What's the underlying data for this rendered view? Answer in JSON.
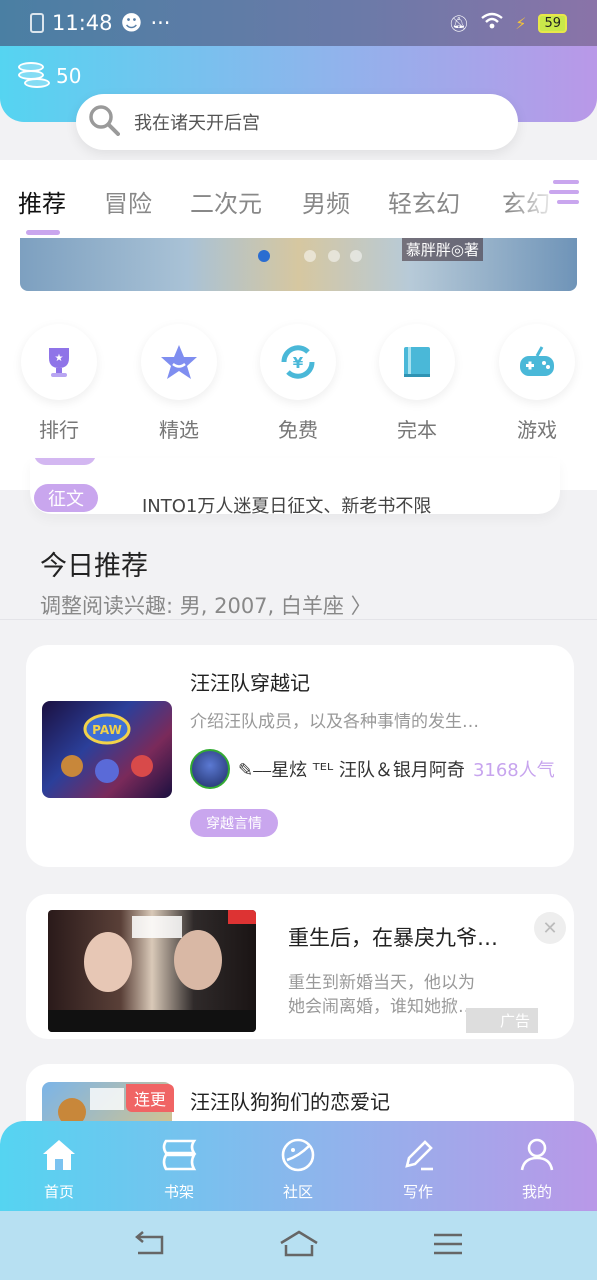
{
  "status_bar": {
    "time": "11:48",
    "extra": "···",
    "battery": "59"
  },
  "header": {
    "coins": "50"
  },
  "search": {
    "placeholder": "我在诸天开后宫"
  },
  "tabs": [
    "推荐",
    "冒险",
    "二次元",
    "男频",
    "轻玄幻",
    "玄幻"
  ],
  "banner": {
    "author": "慕胖胖◎著"
  },
  "quick_links": [
    {
      "label": "排行",
      "icon": "trophy-icon"
    },
    {
      "label": "精选",
      "icon": "star-icon"
    },
    {
      "label": "免费",
      "icon": "yuan-icon"
    },
    {
      "label": "完本",
      "icon": "book-icon"
    },
    {
      "label": "游戏",
      "icon": "gamepad-icon"
    }
  ],
  "notices": [
    {
      "tag": "征文",
      "text": "INTO1万人迷夏日征文、新老书不限"
    }
  ],
  "today": {
    "title": "今日推荐",
    "subtitle": "调整阅读兴趣: 男, 2007, 白羊座 〉"
  },
  "book1": {
    "title": "汪汪队穿越记",
    "desc": "介绍汪队成员，以及各种事情的发生…",
    "author": "✎⎯⎯星炫 ᵀᴱᴸ 汪队＆银月阿奇",
    "popularity": "3168人气",
    "genre": "穿越言情"
  },
  "ad": {
    "title": "重生后，在暴戾九爷…",
    "desc_line1": "重生到新婚当天，他以为",
    "desc_line2": "她会闹离婚，谁知她掀…",
    "badge": "广告"
  },
  "book2": {
    "title": "汪汪队狗狗们的恋爱记",
    "update_tag": "连更"
  },
  "bottom_nav": [
    {
      "label": "首页",
      "icon": "home-icon"
    },
    {
      "label": "书架",
      "icon": "bookshelf-icon"
    },
    {
      "label": "社区",
      "icon": "planet-icon"
    },
    {
      "label": "写作",
      "icon": "pen-icon"
    },
    {
      "label": "我的",
      "icon": "user-icon"
    }
  ],
  "colors": {
    "accent": "#c9a6ee",
    "gradient_start": "#55d4f1",
    "gradient_end": "#b998e8"
  }
}
